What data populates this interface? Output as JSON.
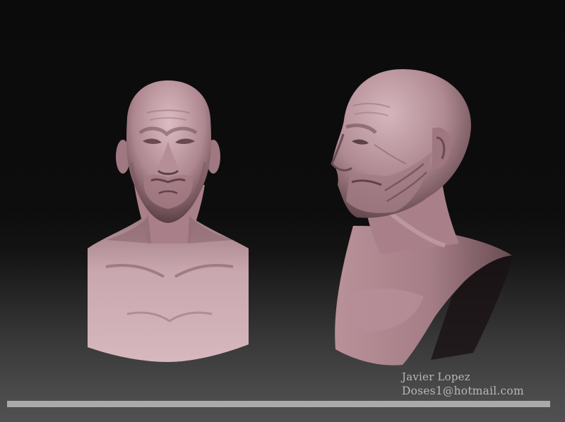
{
  "credit": {
    "author": "Javier Lopez",
    "email": "Doses1@hotmail.com"
  },
  "colors": {
    "skin_light": "#c9a6ad",
    "skin_mid": "#a98089",
    "skin_shadow": "#5a3d44",
    "text": "#b7b7b7",
    "bar": "#a9a9a9"
  }
}
